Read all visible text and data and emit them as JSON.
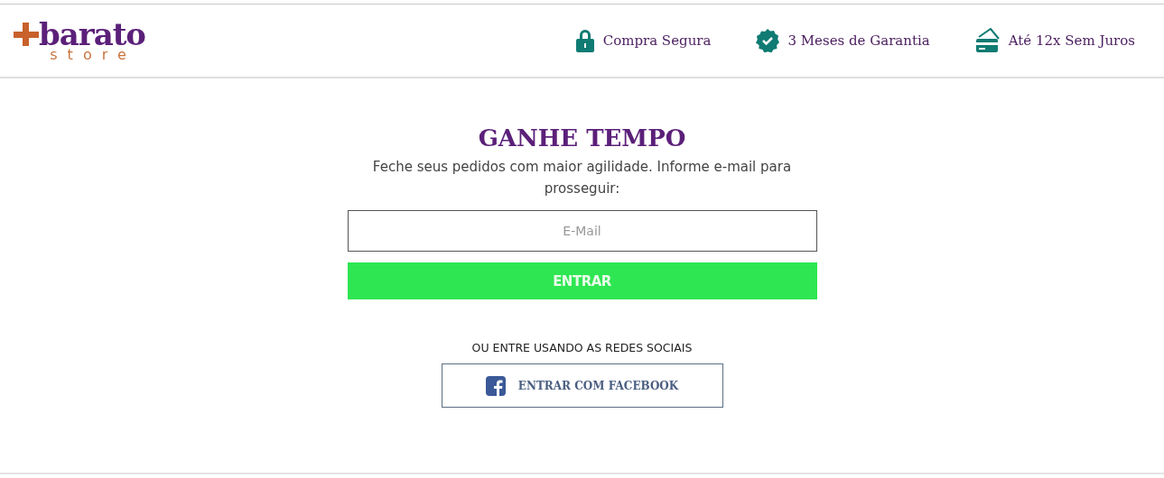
{
  "logo": {
    "name": "barato",
    "tagline": "store"
  },
  "features": [
    {
      "kind": "lock",
      "label": "Compra Segura"
    },
    {
      "kind": "badge",
      "label": "3 Meses de Garantia"
    },
    {
      "kind": "card",
      "label": "Até 12x Sem Juros"
    }
  ],
  "login": {
    "title": "GANHE TEMPO",
    "description": "Feche seus pedidos com maior agilidade. Informe e-mail para prosseguir:",
    "email": {
      "placeholder": "E-Mail"
    },
    "submit": "ENTRAR",
    "social_label": "OU ENTRE USANDO AS REDES SOCIAIS",
    "facebook_button": "ENTRAR COM FACEBOOK"
  }
}
